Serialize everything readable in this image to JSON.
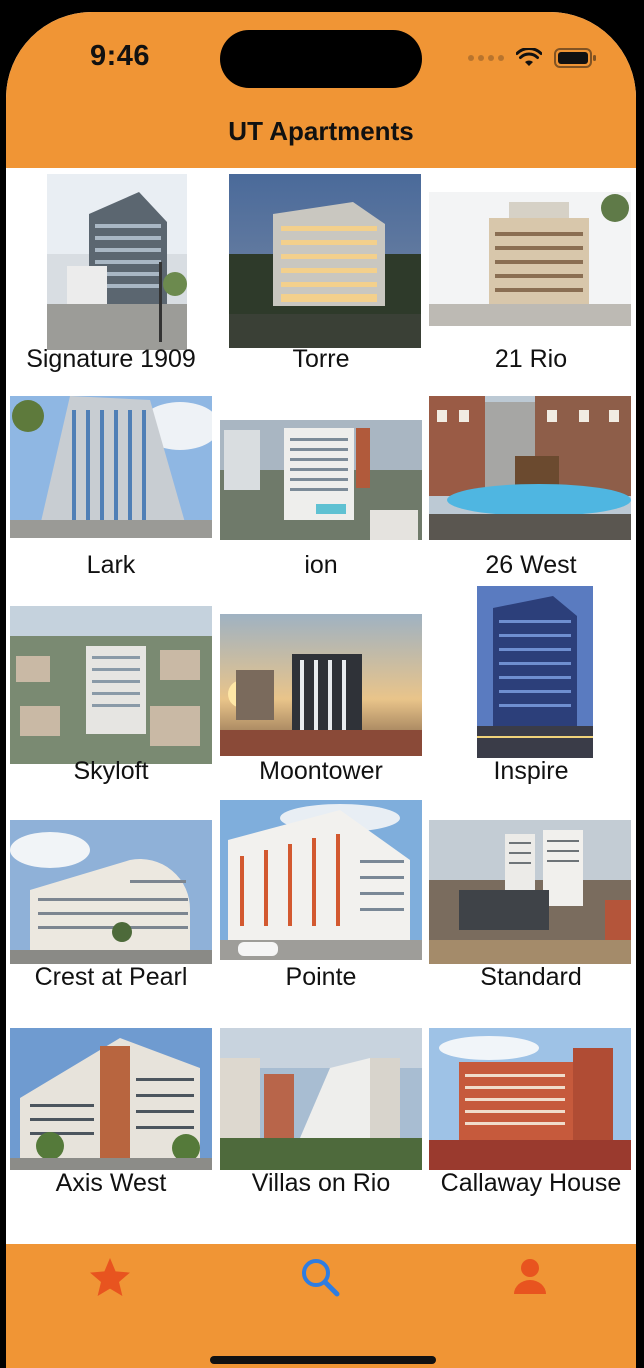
{
  "status": {
    "time": "9:46"
  },
  "nav": {
    "title": "UT Apartments"
  },
  "apartments": [
    {
      "name": "Signature 1909"
    },
    {
      "name": "Torre"
    },
    {
      "name": "21 Rio"
    },
    {
      "name": "Lark"
    },
    {
      "name": "ion"
    },
    {
      "name": "26 West"
    },
    {
      "name": "Skyloft"
    },
    {
      "name": "Moontower"
    },
    {
      "name": "Inspire"
    },
    {
      "name": "Crest at Pearl"
    },
    {
      "name": "Pointe"
    },
    {
      "name": "Standard"
    },
    {
      "name": "Axis West"
    },
    {
      "name": "Villas on Rio"
    },
    {
      "name": "Callaway House"
    }
  ],
  "tabs": [
    {
      "icon": "star-icon",
      "color": "#e8541f"
    },
    {
      "icon": "search-icon",
      "color": "#2f7de1"
    },
    {
      "icon": "person-icon",
      "color": "#e8541f"
    }
  ],
  "colors": {
    "accent": "#f09535"
  }
}
